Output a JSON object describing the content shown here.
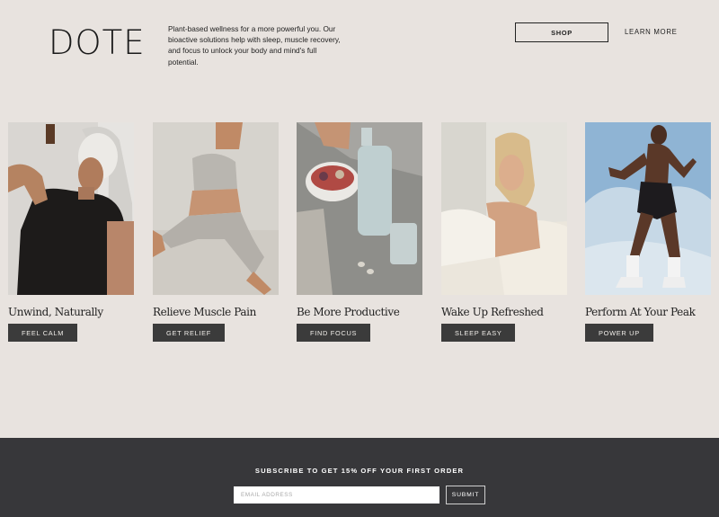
{
  "header": {
    "logo_text": "DOTE",
    "tagline": "Plant-based wellness for a more powerful you. Our bioactive solutions help with sleep, muscle recovery, and focus to unlock your body and mind's full potential.",
    "shop_label": "SHOP",
    "learn_more_label": "LEARN MORE"
  },
  "cards": [
    {
      "title": "Unwind, Naturally",
      "button": "FEEL CALM"
    },
    {
      "title": "Relieve Muscle Pain",
      "button": "GET RELIEF"
    },
    {
      "title": "Be More Productive",
      "button": "FIND FOCUS"
    },
    {
      "title": "Wake Up Refreshed",
      "button": "SLEEP EASY"
    },
    {
      "title": "Perform At Your Peak",
      "button": "POWER UP"
    }
  ],
  "footer": {
    "subscribe_heading": "SUBSCRIBE TO GET 15% OFF YOUR FIRST ORDER",
    "email_placeholder": "EMAIL ADDRESS",
    "submit_label": "SUBMIT"
  },
  "colors": {
    "background": "#e8e3df",
    "footer_bg": "#37373a",
    "button_dark": "#3b3b3b"
  }
}
